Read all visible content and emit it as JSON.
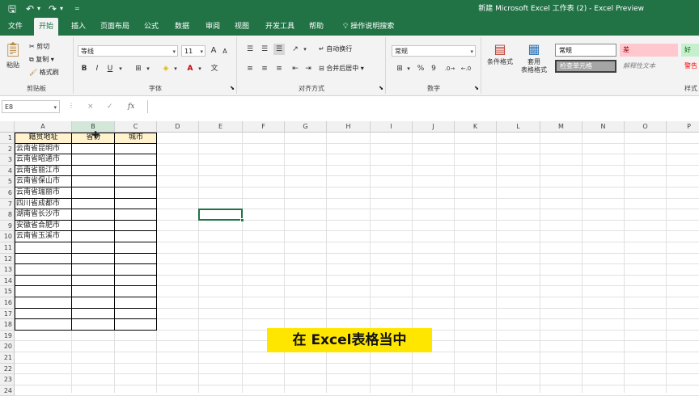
{
  "window": {
    "title": "新建 Microsoft Excel 工作表 (2)  -  Excel Preview"
  },
  "quick_access": {
    "save_icon": "save-icon",
    "undo_icon": "undo-icon",
    "redo_icon": "redo-icon",
    "customize_icon": "customize-icon"
  },
  "tabs": [
    "文件",
    "开始",
    "插入",
    "页面布局",
    "公式",
    "数据",
    "审阅",
    "视图",
    "开发工具",
    "帮助"
  ],
  "tell_me": "操作说明搜索",
  "ribbon": {
    "clipboard": {
      "paste": "粘贴",
      "cut": "剪切",
      "copy": "复制",
      "format_painter": "格式刷",
      "label": "剪贴板"
    },
    "font": {
      "font_name": "等线",
      "font_size": "11",
      "bold": "B",
      "italic": "I",
      "underline": "U",
      "grow": "A",
      "shrink": "A",
      "label": "字体"
    },
    "alignment": {
      "wrap_text": "自动换行",
      "merge_center": "合并后居中",
      "label": "对齐方式"
    },
    "number": {
      "format": "常规",
      "percent": "%",
      "comma": "9",
      "label": "数字"
    },
    "styles": {
      "conditional": "条件格式",
      "table_format_1": "套用",
      "table_format_2": "表格格式",
      "normal": "常规",
      "bad": "差",
      "good": "好",
      "check_cell": "检查单元格",
      "explanatory": "解释性文本",
      "warning": "警告",
      "label": "样式"
    }
  },
  "formula_bar": {
    "name_box": "E8",
    "cancel": "×",
    "enter": "✓",
    "fx": "fx",
    "value": ""
  },
  "columns": [
    "A",
    "B",
    "C",
    "D",
    "E",
    "F",
    "G",
    "H",
    "I",
    "J",
    "K",
    "L",
    "M",
    "N",
    "O",
    "P"
  ],
  "rows": [
    "1",
    "2",
    "3",
    "4",
    "5",
    "6",
    "7",
    "8",
    "9",
    "10",
    "11",
    "12",
    "13",
    "14",
    "15",
    "16",
    "17",
    "18",
    "19",
    "20",
    "21",
    "22",
    "23",
    "24"
  ],
  "table": {
    "headers": [
      "籍贯地址",
      "省份",
      "城市"
    ],
    "addresses": [
      "云南省昆明市",
      "云南省昭通市",
      "云南省丽江市",
      "云南省保山市",
      "云南省瑞丽市",
      "四川省成都市",
      "湖南省长沙市",
      "安徽省合肥市",
      "云南省玉溪市"
    ]
  },
  "selected_cell": "E8",
  "subtitle": "在 Excel表格当中",
  "colors": {
    "excel_green": "#217346",
    "header_fill": "#fff2cc",
    "subtitle_bg": "#ffe600"
  }
}
